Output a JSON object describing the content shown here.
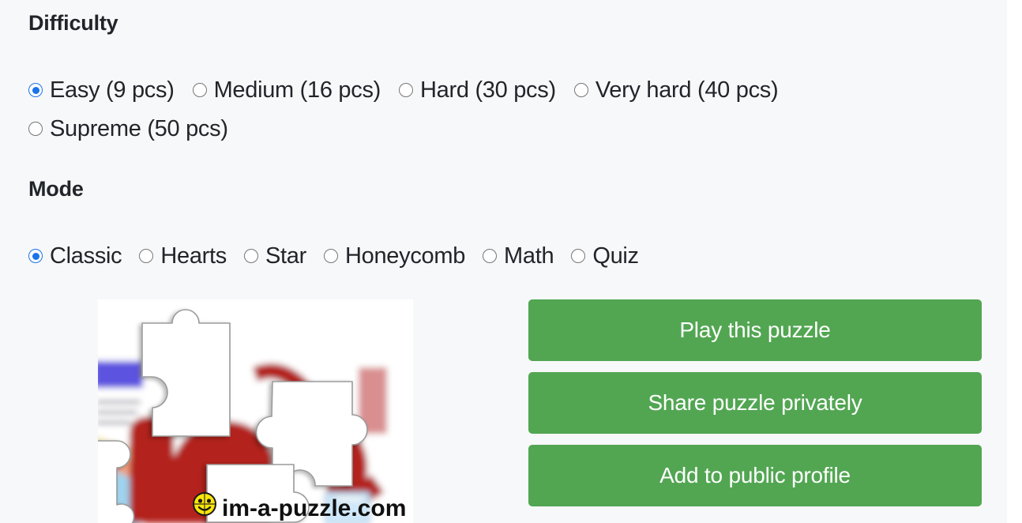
{
  "difficulty": {
    "heading": "Difficulty",
    "options": [
      {
        "label": "Easy (9 pcs)",
        "selected": true
      },
      {
        "label": "Medium (16 pcs)",
        "selected": false
      },
      {
        "label": "Hard (30 pcs)",
        "selected": false
      },
      {
        "label": "Very hard (40 pcs)",
        "selected": false
      },
      {
        "label": "Supreme (50 pcs)",
        "selected": false
      }
    ]
  },
  "mode": {
    "heading": "Mode",
    "options": [
      {
        "label": "Classic",
        "selected": true
      },
      {
        "label": "Hearts",
        "selected": false
      },
      {
        "label": "Star",
        "selected": false
      },
      {
        "label": "Honeycomb",
        "selected": false
      },
      {
        "label": "Math",
        "selected": false
      },
      {
        "label": "Quiz",
        "selected": false
      }
    ]
  },
  "preview": {
    "watermark_text": "im-a-puzzle.com",
    "watermark_icon": "smiley-puzzle-icon"
  },
  "actions": {
    "play_label": "Play this puzzle",
    "share_label": "Share puzzle privately",
    "add_label": "Add to public profile"
  },
  "colors": {
    "page_background": "#f7f8fa",
    "heading_text": "#212529",
    "radio_selected": "#1a73e8",
    "radio_unselected_border": "#767676",
    "button_green": "#52a652",
    "button_text": "#ffffff"
  }
}
